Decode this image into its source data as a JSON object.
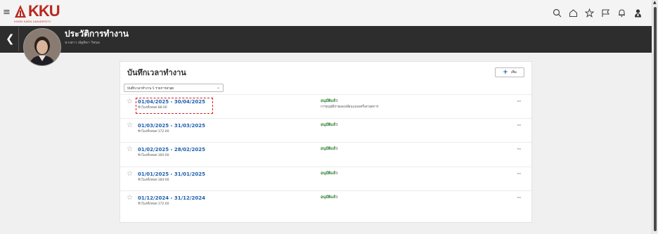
{
  "header": {
    "logo_text": "KKU",
    "logo_subtitle": "KHON KAEN UNIVERSITY",
    "icons": [
      "search-icon",
      "home-icon",
      "star-icon",
      "flag-icon",
      "bell-icon",
      "user-icon"
    ]
  },
  "profile": {
    "title": "ประวัติการทำงาน",
    "subtitle": "นางสาว ณัฐติดา วิชนย"
  },
  "card": {
    "title": "บันทึกเวลาทำงาน",
    "add_label": "เพิ่ม",
    "filter_value": "บันทึกเวลาทำงาน 5 รายการล่าสุด",
    "rows": [
      {
        "range": "01/04/2025  -  30/04/2025",
        "hours": "ชั่วโมงทั้งหมด:88:00",
        "status": "อนุมัติแล้ว",
        "note": "การอนุมัติถ่ายผลเปลี่ยนแปลงครั้งล่าสุดการ",
        "highlighted": true
      },
      {
        "range": "01/03/2025  -  31/03/2025",
        "hours": "ชั่วโมงทั้งหมด:172:00",
        "status": "อนุมัติแล้ว",
        "note": "",
        "highlighted": false
      },
      {
        "range": "01/02/2025  -  28/02/2025",
        "hours": "ชั่วโมงทั้งหมด:160:00",
        "status": "อนุมัติแล้ว",
        "note": "",
        "highlighted": false
      },
      {
        "range": "01/01/2025  -  31/01/2025",
        "hours": "ชั่วโมงทั้งหมด:184:00",
        "status": "อนุมัติแล้ว",
        "note": "",
        "highlighted": false
      },
      {
        "range": "01/12/2024  -  31/12/2024",
        "hours": "ชั่วโมงทั้งหมด:172:00",
        "status": "อนุมัติแล้ว",
        "note": "",
        "highlighted": false
      }
    ]
  },
  "colors": {
    "brand": "#b8281e",
    "link": "#1e5fae",
    "approved": "#2e7d32",
    "highlight": "#d11e1e",
    "band": "#2d2d2d"
  }
}
